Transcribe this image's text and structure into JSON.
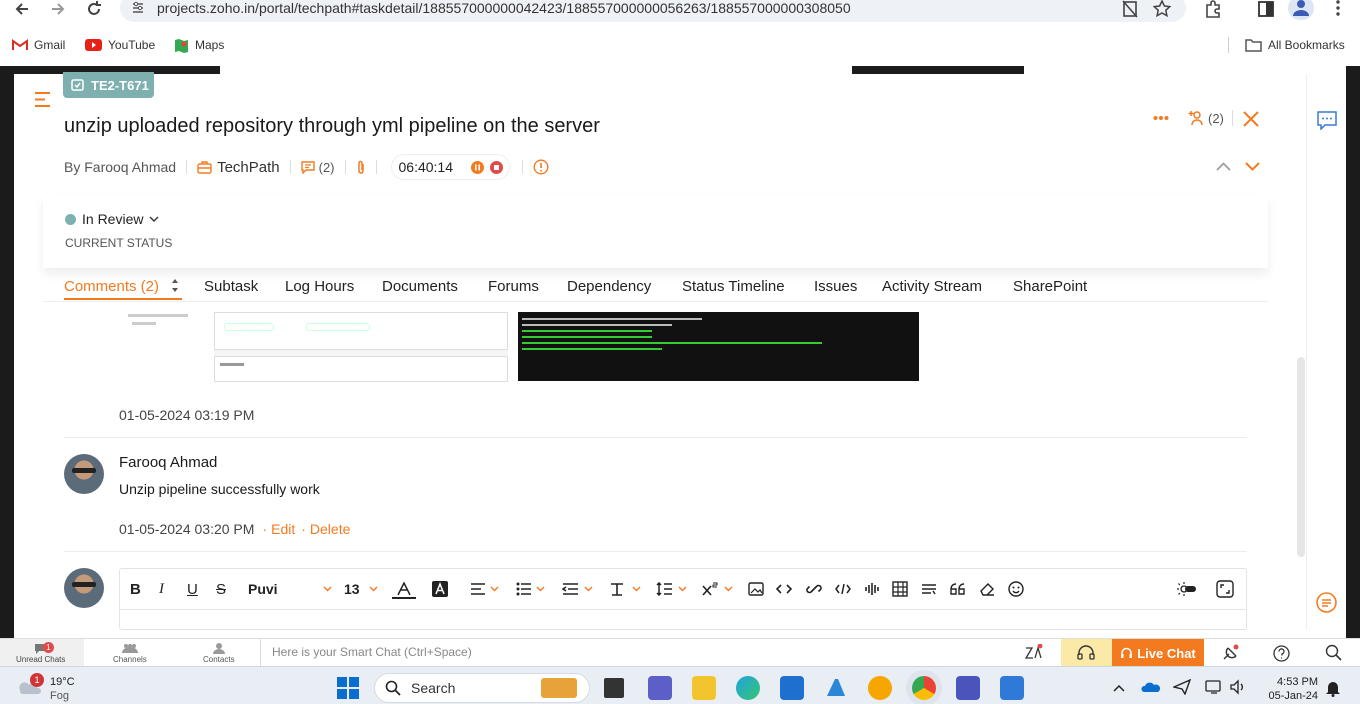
{
  "browser": {
    "url": "projects.zoho.in/portal/techpath#taskdetail/188557000000042423/188557000000056263/188557000000308050",
    "bookmarks": [
      {
        "label": "Gmail",
        "icon": "gmail-icon"
      },
      {
        "label": "YouTube",
        "icon": "youtube-icon"
      },
      {
        "label": "Maps",
        "icon": "maps-icon"
      }
    ],
    "all_bookmarks": "All Bookmarks"
  },
  "task": {
    "id": "TE2-T671",
    "title": "unzip uploaded repository through yml pipeline on the server",
    "author": "By Farooq Ahmad",
    "project": "TechPath",
    "comment_count": "(2)",
    "timer": "06:40:14",
    "followers_count": "(2)"
  },
  "status": {
    "value": "In Review",
    "caption": "CURRENT STATUS",
    "color": "#7fb0b0"
  },
  "tabs": [
    {
      "label": "Comments (2)",
      "active": true
    },
    {
      "label": "Subtask"
    },
    {
      "label": "Log Hours"
    },
    {
      "label": "Documents"
    },
    {
      "label": "Forums"
    },
    {
      "label": "Dependency"
    },
    {
      "label": "Status Timeline"
    },
    {
      "label": "Issues"
    },
    {
      "label": "Activity Stream"
    },
    {
      "label": "SharePoint"
    }
  ],
  "comments": [
    {
      "date": "01-05-2024 03:19 PM"
    },
    {
      "author": "Farooq Ahmad",
      "text": "Unzip pipeline successfully work",
      "date": "01-05-2024 03:20 PM",
      "edit": "Edit",
      "delete": "Delete"
    }
  ],
  "editor": {
    "font": "Puvi",
    "size": "13"
  },
  "chatbar": {
    "unread_chats": "Unread Chats",
    "unread_badge": "1",
    "channels": "Channels",
    "contacts": "Contacts",
    "smart_chat_placeholder": "Here is your Smart Chat (Ctrl+Space)",
    "live_chat": "Live Chat"
  },
  "taskbar": {
    "weather_temp": "19°C",
    "weather_desc": "Fog",
    "weather_badge": "1",
    "search": "Search",
    "time": "4:53 PM",
    "date": "05-Jan-24"
  },
  "colors": {
    "accent": "#f47a20"
  }
}
